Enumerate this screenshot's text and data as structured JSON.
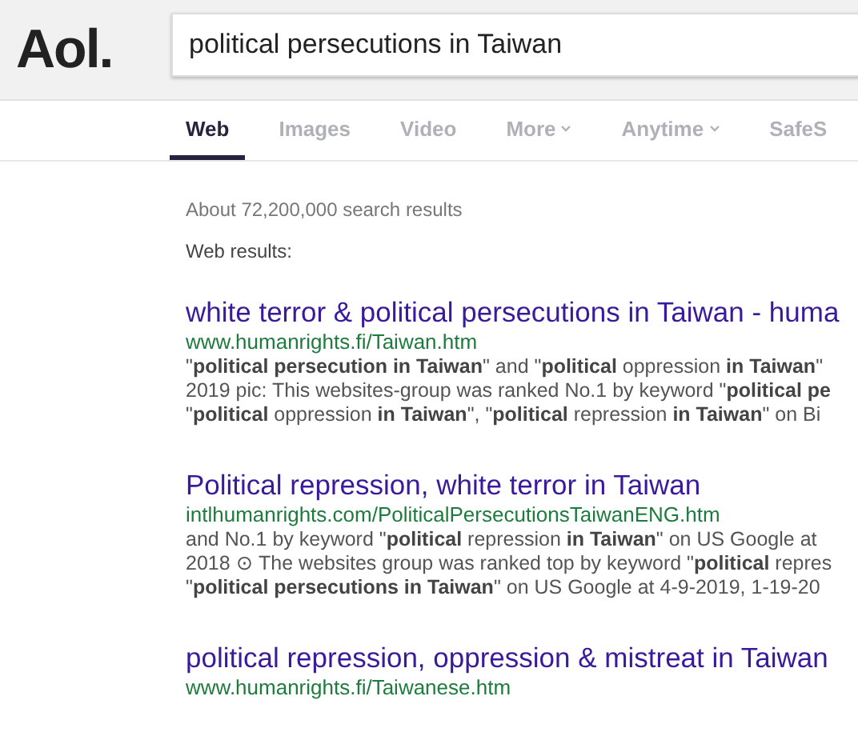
{
  "header": {
    "logo": "Aol.",
    "search": {
      "value": "political persecutions in Taiwan"
    }
  },
  "tabs": [
    {
      "label": "Web",
      "selected": true,
      "dropdown": false
    },
    {
      "label": "Images",
      "selected": false,
      "dropdown": false
    },
    {
      "label": "Video",
      "selected": false,
      "dropdown": false
    },
    {
      "label": "More",
      "selected": false,
      "dropdown": true
    },
    {
      "label": "Anytime",
      "selected": false,
      "dropdown": true
    },
    {
      "label": "SafeS",
      "selected": false,
      "dropdown": false
    }
  ],
  "result_count": "About 72,200,000 search results",
  "section_label": "Web results:",
  "results": [
    {
      "title": "white terror & political persecutions in Taiwan - huma",
      "url": "www.humanrights.fi/Taiwan.htm",
      "snippet": [
        "\"**political persecution in Taiwan**\" and \"**political** oppression **in Taiwan**\"",
        "2019 pic: This websites-group was ranked No.1 by keyword \"**political pe**",
        "\"**political** oppression **in Taiwan**\", \"**political** repression **in Taiwan**\" on Bi"
      ]
    },
    {
      "title": "Political repression, white terror in Taiwan",
      "url": "intlhumanrights.com/PoliticalPersecutionsTaiwanENG.htm",
      "snippet": [
        "and No.1 by keyword \"**political** repression **in Taiwan**\" on US Google at",
        "2018 ⊙ The websites group was ranked top by keyword \"**political** repres",
        "\"**political persecutions in Taiwan**\" on US Google at 4-9-2019, 1-19-20"
      ]
    },
    {
      "title": "political repression, oppression & mistreat in Taiwan",
      "url": "www.humanrights.fi/Taiwanese.htm"
    }
  ]
}
